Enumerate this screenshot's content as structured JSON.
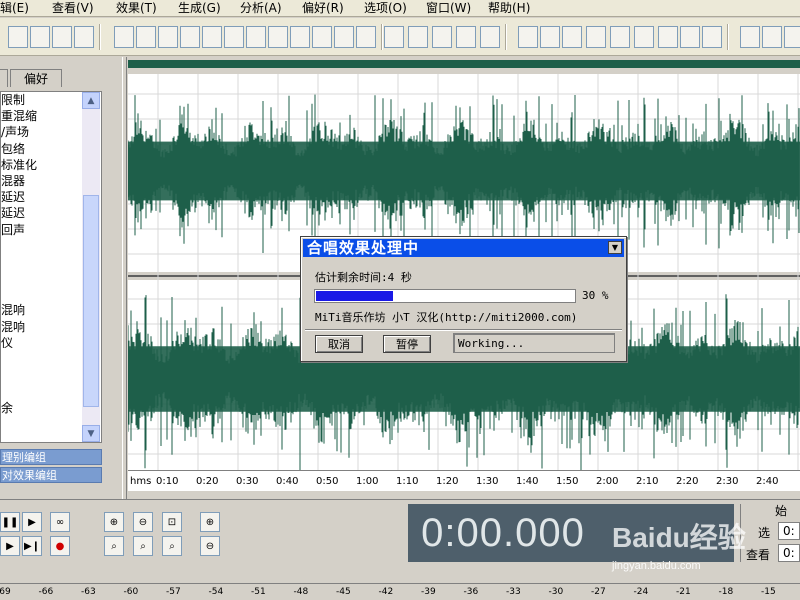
{
  "menu": [
    "辑(E)",
    "查看(V)",
    "效果(T)",
    "生成(G)",
    "分析(A)",
    "偏好(R)",
    "选项(O)",
    "窗口(W)",
    "帮助(H)"
  ],
  "left_panel": {
    "tab_label": "偏好",
    "items": [
      "限制",
      "重混缩",
      "/声场",
      "包络",
      "标准化",
      "混器",
      "延迟",
      "延迟",
      "回声",
      "",
      "",
      "",
      "",
      "混响",
      "混响",
      "仪",
      "",
      "",
      "",
      "余",
      "",
      ""
    ],
    "buttons": [
      "理别编组",
      "对效果编组"
    ]
  },
  "ruler": {
    "unit": "hms",
    "labels": [
      "0:10",
      "0:20",
      "0:30",
      "0:40",
      "0:50",
      "1:00",
      "1:10",
      "1:20",
      "1:30",
      "1:40",
      "1:50",
      "2:00",
      "2:10",
      "2:20",
      "2:30",
      "2:40"
    ]
  },
  "time_display": "0:00.000",
  "side_panel": {
    "header": "始",
    "labels": [
      "选",
      "查看"
    ],
    "values": [
      "0:",
      "0:"
    ]
  },
  "meter_labels": [
    "-69",
    "-66",
    "-63",
    "-60",
    "-57",
    "-54",
    "-51",
    "-48",
    "-45",
    "-42",
    "-39",
    "-36",
    "-33",
    "-30",
    "-27",
    "-24",
    "-21",
    "-18",
    "-15"
  ],
  "dialog": {
    "title": "合唱效果处理中",
    "remaining": "估计剩余时间:4 秒",
    "progress": 0.3,
    "progress_label": "30 %",
    "credit": "MiTi音乐作坊 小T 汉化(http://miti2000.com)",
    "cancel_label": "取消",
    "pause_label": "暂停",
    "status": "Working..."
  },
  "watermark": {
    "text": "Baidu经验",
    "url": "jingyan.baidu.com"
  },
  "colors": {
    "wave": "#1e5f4a",
    "wave_bg": "#ffffff",
    "grid": "#d8d8d8",
    "title_bar": "#0a4ee8",
    "progress": "#1919e6",
    "time_bg": "#4e5f6b"
  }
}
